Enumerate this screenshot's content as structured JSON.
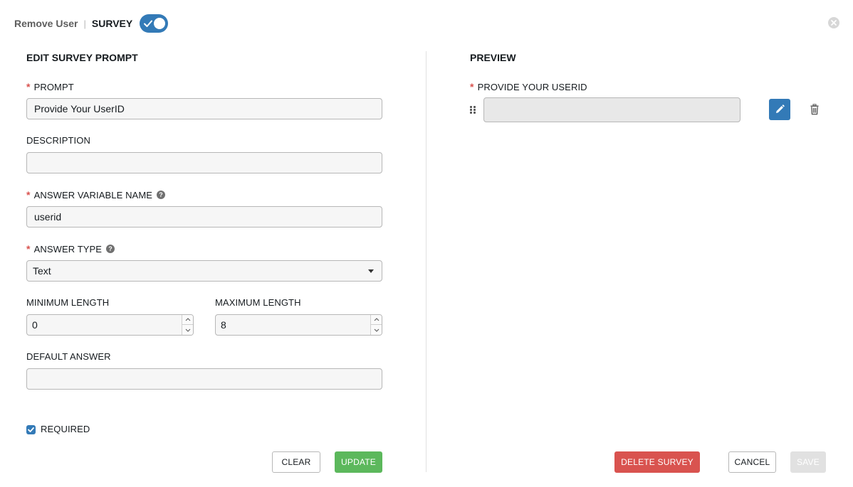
{
  "header": {
    "title": "Remove User",
    "separator": "|",
    "section": "SURVEY",
    "toggle_on": true
  },
  "edit_panel": {
    "title": "EDIT SURVEY PROMPT",
    "prompt": {
      "label": "PROMPT",
      "required": true,
      "value": "Provide Your UserID"
    },
    "description": {
      "label": "DESCRIPTION",
      "required": false,
      "value": ""
    },
    "answer_variable_name": {
      "label": "ANSWER VARIABLE NAME",
      "required": true,
      "value": "userid",
      "help_icon": "question-circle-icon"
    },
    "answer_type": {
      "label": "ANSWER TYPE",
      "required": true,
      "value": "Text",
      "help_icon": "question-circle-icon"
    },
    "minimum_length": {
      "label": "MINIMUM LENGTH",
      "value": "0"
    },
    "maximum_length": {
      "label": "MAXIMUM LENGTH",
      "value": "8"
    },
    "default_answer": {
      "label": "DEFAULT ANSWER",
      "value": ""
    },
    "required_checkbox": {
      "label": "REQUIRED",
      "checked": true
    },
    "buttons": {
      "clear": "CLEAR",
      "update": "UPDATE"
    }
  },
  "preview_panel": {
    "title": "PREVIEW",
    "question": {
      "label": "PROVIDE YOUR USERID",
      "required": true,
      "value": ""
    },
    "icons": {
      "drag": "drag-handle-icon",
      "edit": "pencil-icon",
      "delete": "trash-icon"
    }
  },
  "footer": {
    "delete_survey": "DELETE SURVEY",
    "cancel": "CANCEL",
    "save": "SAVE"
  },
  "colors": {
    "primary": "#337ab7",
    "success": "#5cb85c",
    "danger": "#d9534f",
    "required_asterisk": "#d9534f",
    "disabled": "#e1e1e1"
  }
}
